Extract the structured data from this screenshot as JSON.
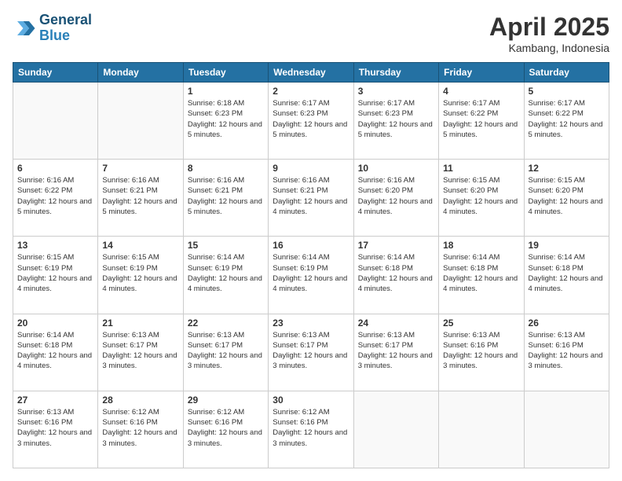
{
  "header": {
    "logo_line1": "General",
    "logo_line2": "Blue",
    "month_title": "April 2025",
    "location": "Kambang, Indonesia"
  },
  "weekdays": [
    "Sunday",
    "Monday",
    "Tuesday",
    "Wednesday",
    "Thursday",
    "Friday",
    "Saturday"
  ],
  "rows": [
    [
      {
        "day": "",
        "info": ""
      },
      {
        "day": "",
        "info": ""
      },
      {
        "day": "1",
        "info": "Sunrise: 6:18 AM\nSunset: 6:23 PM\nDaylight: 12 hours and 5 minutes."
      },
      {
        "day": "2",
        "info": "Sunrise: 6:17 AM\nSunset: 6:23 PM\nDaylight: 12 hours and 5 minutes."
      },
      {
        "day": "3",
        "info": "Sunrise: 6:17 AM\nSunset: 6:23 PM\nDaylight: 12 hours and 5 minutes."
      },
      {
        "day": "4",
        "info": "Sunrise: 6:17 AM\nSunset: 6:22 PM\nDaylight: 12 hours and 5 minutes."
      },
      {
        "day": "5",
        "info": "Sunrise: 6:17 AM\nSunset: 6:22 PM\nDaylight: 12 hours and 5 minutes."
      }
    ],
    [
      {
        "day": "6",
        "info": "Sunrise: 6:16 AM\nSunset: 6:22 PM\nDaylight: 12 hours and 5 minutes."
      },
      {
        "day": "7",
        "info": "Sunrise: 6:16 AM\nSunset: 6:21 PM\nDaylight: 12 hours and 5 minutes."
      },
      {
        "day": "8",
        "info": "Sunrise: 6:16 AM\nSunset: 6:21 PM\nDaylight: 12 hours and 5 minutes."
      },
      {
        "day": "9",
        "info": "Sunrise: 6:16 AM\nSunset: 6:21 PM\nDaylight: 12 hours and 4 minutes."
      },
      {
        "day": "10",
        "info": "Sunrise: 6:16 AM\nSunset: 6:20 PM\nDaylight: 12 hours and 4 minutes."
      },
      {
        "day": "11",
        "info": "Sunrise: 6:15 AM\nSunset: 6:20 PM\nDaylight: 12 hours and 4 minutes."
      },
      {
        "day": "12",
        "info": "Sunrise: 6:15 AM\nSunset: 6:20 PM\nDaylight: 12 hours and 4 minutes."
      }
    ],
    [
      {
        "day": "13",
        "info": "Sunrise: 6:15 AM\nSunset: 6:19 PM\nDaylight: 12 hours and 4 minutes."
      },
      {
        "day": "14",
        "info": "Sunrise: 6:15 AM\nSunset: 6:19 PM\nDaylight: 12 hours and 4 minutes."
      },
      {
        "day": "15",
        "info": "Sunrise: 6:14 AM\nSunset: 6:19 PM\nDaylight: 12 hours and 4 minutes."
      },
      {
        "day": "16",
        "info": "Sunrise: 6:14 AM\nSunset: 6:19 PM\nDaylight: 12 hours and 4 minutes."
      },
      {
        "day": "17",
        "info": "Sunrise: 6:14 AM\nSunset: 6:18 PM\nDaylight: 12 hours and 4 minutes."
      },
      {
        "day": "18",
        "info": "Sunrise: 6:14 AM\nSunset: 6:18 PM\nDaylight: 12 hours and 4 minutes."
      },
      {
        "day": "19",
        "info": "Sunrise: 6:14 AM\nSunset: 6:18 PM\nDaylight: 12 hours and 4 minutes."
      }
    ],
    [
      {
        "day": "20",
        "info": "Sunrise: 6:14 AM\nSunset: 6:18 PM\nDaylight: 12 hours and 4 minutes."
      },
      {
        "day": "21",
        "info": "Sunrise: 6:13 AM\nSunset: 6:17 PM\nDaylight: 12 hours and 3 minutes."
      },
      {
        "day": "22",
        "info": "Sunrise: 6:13 AM\nSunset: 6:17 PM\nDaylight: 12 hours and 3 minutes."
      },
      {
        "day": "23",
        "info": "Sunrise: 6:13 AM\nSunset: 6:17 PM\nDaylight: 12 hours and 3 minutes."
      },
      {
        "day": "24",
        "info": "Sunrise: 6:13 AM\nSunset: 6:17 PM\nDaylight: 12 hours and 3 minutes."
      },
      {
        "day": "25",
        "info": "Sunrise: 6:13 AM\nSunset: 6:16 PM\nDaylight: 12 hours and 3 minutes."
      },
      {
        "day": "26",
        "info": "Sunrise: 6:13 AM\nSunset: 6:16 PM\nDaylight: 12 hours and 3 minutes."
      }
    ],
    [
      {
        "day": "27",
        "info": "Sunrise: 6:13 AM\nSunset: 6:16 PM\nDaylight: 12 hours and 3 minutes."
      },
      {
        "day": "28",
        "info": "Sunrise: 6:12 AM\nSunset: 6:16 PM\nDaylight: 12 hours and 3 minutes."
      },
      {
        "day": "29",
        "info": "Sunrise: 6:12 AM\nSunset: 6:16 PM\nDaylight: 12 hours and 3 minutes."
      },
      {
        "day": "30",
        "info": "Sunrise: 6:12 AM\nSunset: 6:16 PM\nDaylight: 12 hours and 3 minutes."
      },
      {
        "day": "",
        "info": ""
      },
      {
        "day": "",
        "info": ""
      },
      {
        "day": "",
        "info": ""
      }
    ]
  ]
}
